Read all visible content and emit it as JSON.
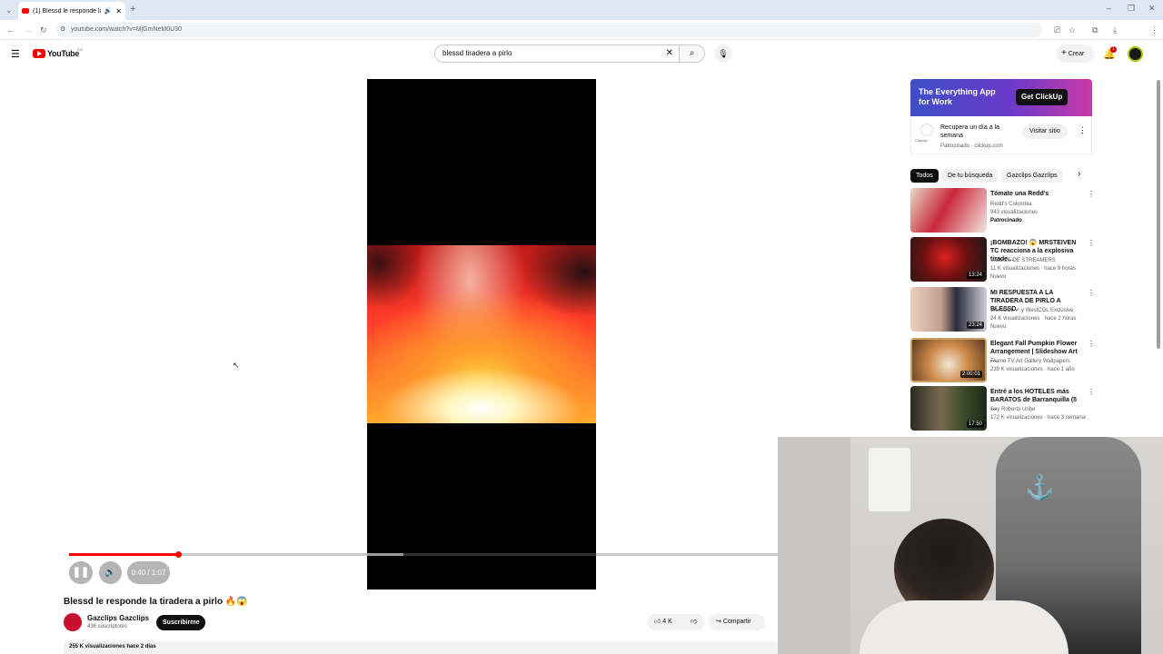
{
  "browser": {
    "tab_title": "(1) Blessd le responde la ti",
    "url": "youtube.com/watch?v=MjGmNeM0U30"
  },
  "header": {
    "logo_text": "YouTube",
    "logo_sup": "CO",
    "search_value": "blessd tiradera a pirlo",
    "create_label": "Crear",
    "notif_count": "1"
  },
  "player": {
    "time_text": "0:40 / 1:07",
    "progress_fraction": 0.154,
    "buffer_fraction": 0.472
  },
  "video": {
    "title": "Blessd le responde la tiradera a pirlo 🔥😱",
    "channel_name": "Gazclips Gazclips",
    "subscribers": "436 suscriptores",
    "subscribe_label": "Suscribirme",
    "likes": "4 K",
    "share_label": "Compartir",
    "stats": "255 K visualizaciones  hace 2 días"
  },
  "ad": {
    "banner_title": "The Everything App for Work",
    "banner_cta": "Get  ClickUp",
    "brand": "ClickUp",
    "description": "Recupera un día a la semana",
    "sponsored": "Patrocinado · clickup.com",
    "visit_label": "Visitar sitio"
  },
  "chips": [
    "Todos",
    "De tu búsqueda",
    "Gazclips Gazclips"
  ],
  "recommendations": [
    {
      "title": "Tómate una Redd's",
      "channel": "Redd's Colombia",
      "views": "943 visualizaciones",
      "extra": "Patrocinado",
      "duration": ""
    },
    {
      "title": "¡BOMBAZO! 😱 MRSTEIVEN TC reacciona a la explosiva tirade…",
      "channel": "VIDEOS DE STREAMERS",
      "views": "11 K visualizaciones · hace 9 horas",
      "extra": "Nuevo",
      "duration": "13:24"
    },
    {
      "title": "MI RESPUESTA A LA TIRADERA DE PIRLO A BLESSD",
      "channel": "WestCOL ✔ y WestCOL Exclusive",
      "views": "24 K visualizaciones · hace 2 horas",
      "extra": "Nuevo",
      "duration": "23:24"
    },
    {
      "title": "Elegant Fall Pumpkin Flower Arrangement | Slideshow Art …",
      "channel": "Frame TV Art Gallery Wallpapers",
      "views": "239 K visualizaciones · hace 1 año",
      "extra": "",
      "duration": "2:00:01"
    },
    {
      "title": "Entré a los HOTELES más BARATOS de Barranquilla (5 …",
      "channel": "Soy Roberto Uribe",
      "views": "172 K visualizaciones · hace 3 semanas",
      "extra": "",
      "duration": "17:50"
    }
  ],
  "colors": {
    "accent": "#ff0000",
    "ad_start": "#3d4fc9",
    "ad_end": "#c83aa8"
  }
}
